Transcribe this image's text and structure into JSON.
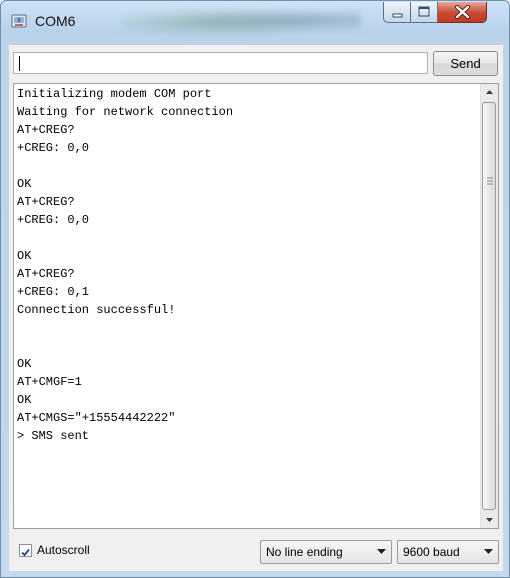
{
  "window": {
    "title": "COM6"
  },
  "toolbar": {
    "send_input_value": "",
    "send_label": "Send"
  },
  "serial_output": {
    "lines": [
      "Initializing modem COM port",
      "Waiting for network connection",
      "AT+CREG?",
      "+CREG: 0,0",
      "",
      "OK",
      "AT+CREG?",
      "+CREG: 0,0",
      "",
      "OK",
      "AT+CREG?",
      "+CREG: 0,1",
      "Connection successful!",
      "",
      "",
      "OK",
      "AT+CMGF=1",
      "OK",
      "AT+CMGS=\"+15554442222\"",
      "> SMS sent"
    ]
  },
  "footer": {
    "autoscroll_label": "Autoscroll",
    "autoscroll_checked": true,
    "line_ending_selected": "No line ending",
    "baud_selected": "9600 baud"
  },
  "icons": {
    "app": "serial-monitor-icon",
    "minimize": "minimize-icon",
    "maximize": "maximize-icon",
    "close": "close-icon"
  },
  "colors": {
    "close_button": "#c74a32",
    "titlebar": "#b9d2ec"
  }
}
